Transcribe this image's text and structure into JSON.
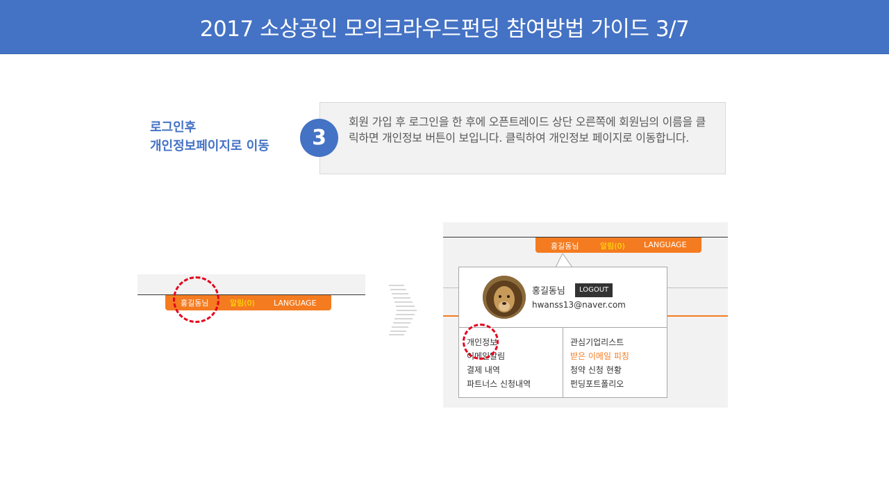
{
  "title": "2017 소상공인 모의크라우드펀딩 참여방법 가이드 3/7",
  "step": {
    "number": "3",
    "label_line1": "로그인후",
    "label_line2": "개인정보페이지로 이동",
    "description": "회원 가입 후 로그인을 한 후에 오픈트레이드 상단 오른쪽에 회원님의 이름을 클릭하면 개인정보 버튼이 보입니다. 클릭하여 개인정보 페이지로 이동합니다."
  },
  "header_bar": {
    "user": "홍길동님",
    "alarm": "알림(0)",
    "language": "LANGUAGE"
  },
  "popup": {
    "name": "홍길동님",
    "logout": "LOGOUT",
    "email": "hwanss13@naver.com",
    "menu_left": [
      "개인정보",
      "이메일알림",
      "결제 내역",
      "파트너스 신청내역"
    ],
    "menu_right": [
      "관심기업리스트",
      "받은 이메일 피칭",
      "청약 신청 현황",
      "펀딩포트폴리오"
    ]
  },
  "colors": {
    "title_bg": "#4472c4",
    "accent_orange": "#f47b20",
    "alarm_yellow": "#ffef00",
    "highlight_red": "#e4001b"
  },
  "icons": {
    "step_arrow": "chevron-right-icon",
    "avatar": "lion-avatar"
  }
}
